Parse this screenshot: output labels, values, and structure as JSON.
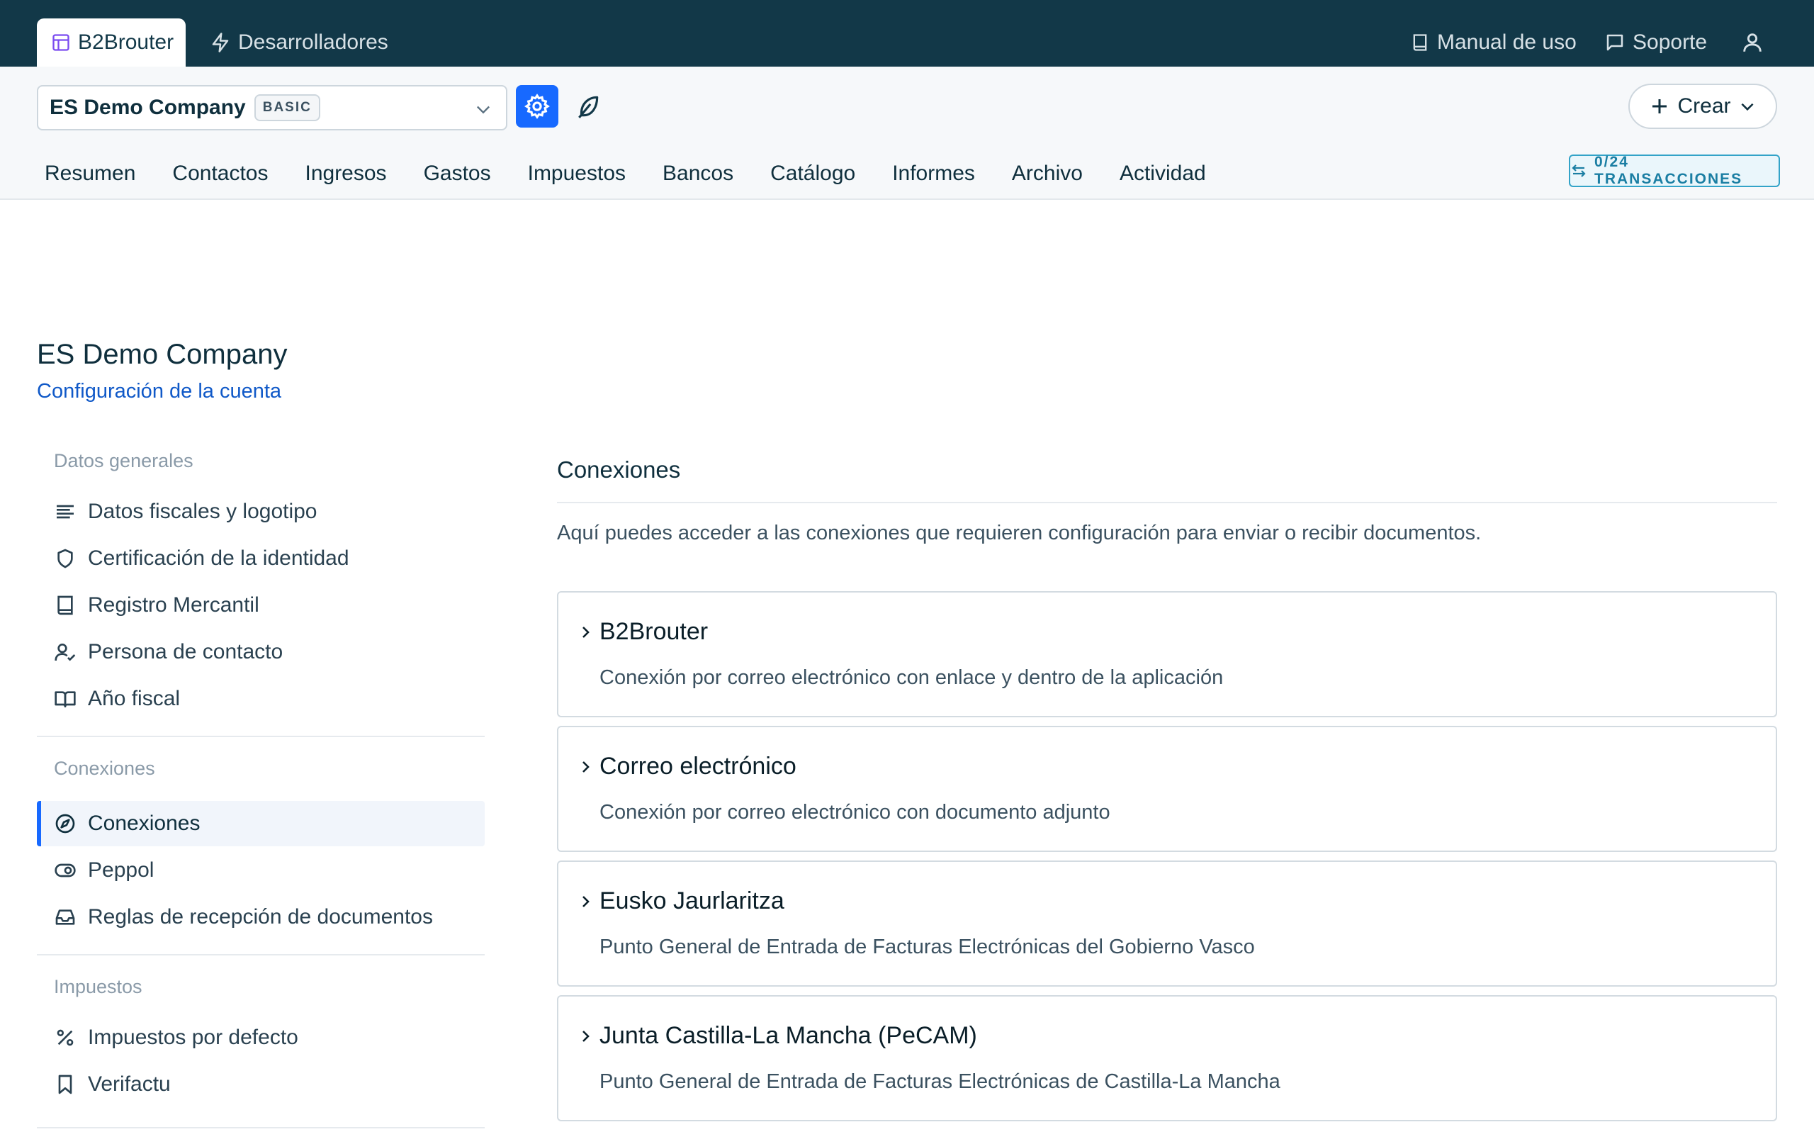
{
  "topbar": {
    "tabs": [
      {
        "label": "B2Brouter",
        "icon": "layout-icon"
      },
      {
        "label": "Desarrolladores",
        "icon": "lightning-icon"
      }
    ],
    "manual_label": "Manual de uso",
    "support_label": "Soporte"
  },
  "company_selector": {
    "name": "ES Demo Company",
    "plan": "BASIC"
  },
  "create_button": {
    "label": "Crear"
  },
  "main_nav": [
    "Resumen",
    "Contactos",
    "Ingresos",
    "Gastos",
    "Impuestos",
    "Bancos",
    "Catálogo",
    "Informes",
    "Archivo",
    "Actividad"
  ],
  "transactions_badge": "0/24 TRANSACCIONES",
  "page": {
    "title": "ES Demo Company",
    "subtitle": "Configuración de la cuenta"
  },
  "sidebar": {
    "groups": [
      {
        "label": "Datos generales",
        "items": [
          {
            "label": "Datos fiscales y logotipo",
            "icon": "align-left-icon"
          },
          {
            "label": "Certificación de la identidad",
            "icon": "shield-icon"
          },
          {
            "label": "Registro Mercantil",
            "icon": "book-icon"
          },
          {
            "label": "Persona de contacto",
            "icon": "user-check-icon"
          },
          {
            "label": "Año fiscal",
            "icon": "book-open-icon"
          }
        ]
      },
      {
        "label": "Conexiones",
        "items": [
          {
            "label": "Conexiones",
            "icon": "compass-icon",
            "active": true
          },
          {
            "label": "Peppol",
            "icon": "toggle-icon"
          },
          {
            "label": "Reglas de recepción de documentos",
            "icon": "inbox-icon"
          }
        ]
      },
      {
        "label": "Impuestos",
        "items": [
          {
            "label": "Impuestos por defecto",
            "icon": "percent-icon"
          },
          {
            "label": "Verifactu",
            "icon": "bookmark-icon"
          }
        ]
      }
    ]
  },
  "content": {
    "title": "Conexiones",
    "description": "Aquí puedes acceder a las conexiones que requieren configuración para enviar o recibir documentos.",
    "connections": [
      {
        "title": "B2Brouter",
        "description": "Conexión por correo electrónico con enlace y dentro de la aplicación"
      },
      {
        "title": "Correo electrónico",
        "description": "Conexión por correo electrónico con documento adjunto"
      },
      {
        "title": "Eusko Jaurlaritza",
        "description": "Punto General de Entrada de Facturas Electrónicas del Gobierno Vasco"
      },
      {
        "title": "Junta Castilla-La Mancha (PeCAM)",
        "description": "Punto General de Entrada de Facturas Electrónicas de Castilla-La Mancha"
      }
    ]
  },
  "colors": {
    "topbar": "#123848",
    "accent": "#1769ff",
    "link": "#1059c8",
    "badge": "#1a7ea3"
  }
}
